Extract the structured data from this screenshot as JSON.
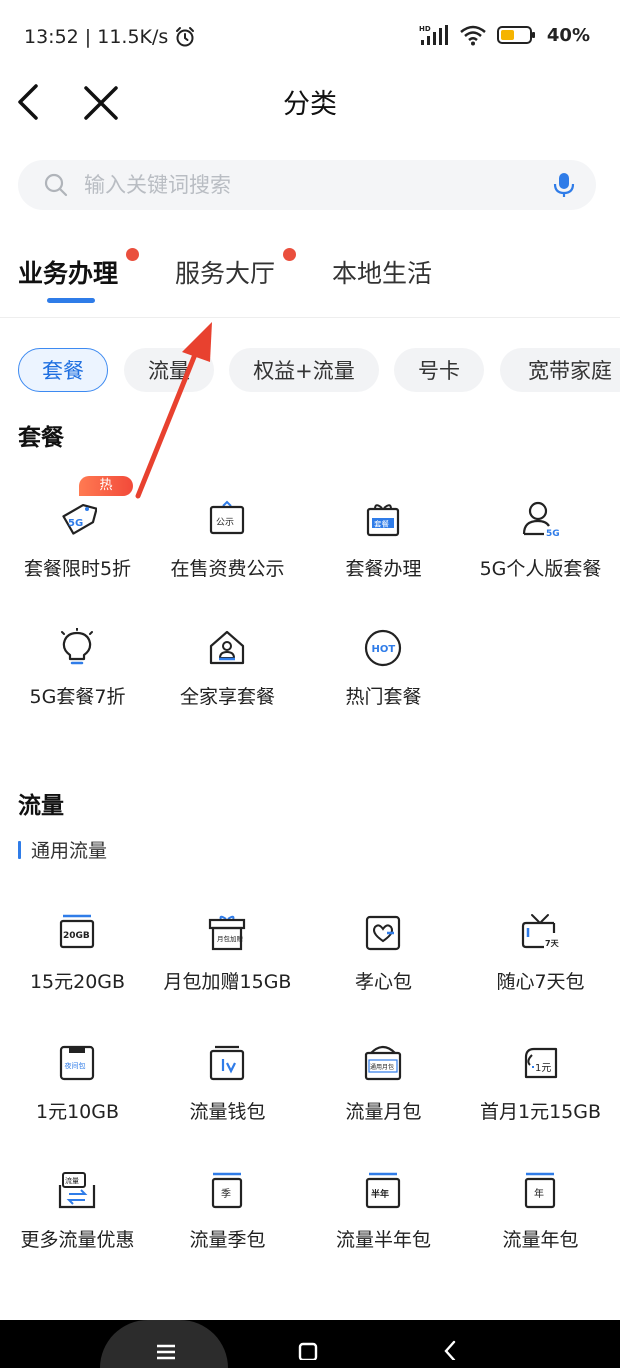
{
  "status_bar": {
    "time_speed": "13:52 | 11.5K/s",
    "hd": "HD",
    "battery": "40%"
  },
  "nav": {
    "title": "分类"
  },
  "search": {
    "placeholder": "输入关键词搜索"
  },
  "tabs": [
    {
      "label": "业务办理",
      "active": true,
      "dot": true
    },
    {
      "label": "服务大厅",
      "active": false,
      "dot": true
    },
    {
      "label": "本地生活",
      "active": false,
      "dot": false
    }
  ],
  "chips": [
    {
      "label": "套餐",
      "active": true
    },
    {
      "label": "流量",
      "active": false
    },
    {
      "label": "权益+流量",
      "active": false
    },
    {
      "label": "号卡",
      "active": false
    },
    {
      "label": "宽带家庭",
      "active": false
    }
  ],
  "section_plan": {
    "title": "套餐",
    "hot_badge": "热",
    "items": [
      {
        "label": "套餐限时5折",
        "icon": "5g-tag-icon",
        "icon_text": "5G"
      },
      {
        "label": "在售资费公示",
        "icon": "notice-board-icon",
        "icon_text": "公示"
      },
      {
        "label": "套餐办理",
        "icon": "gift-box-icon",
        "icon_text": "套餐"
      },
      {
        "label": "5G个人版套餐",
        "icon": "user-5g-icon",
        "icon_text": "5G"
      },
      {
        "label": "5G套餐7折",
        "icon": "lightbulb-icon",
        "icon_text": ""
      },
      {
        "label": "全家享套餐",
        "icon": "family-house-icon",
        "icon_text": ""
      },
      {
        "label": "热门套餐",
        "icon": "hot-circle-icon",
        "icon_text": "HOT"
      }
    ]
  },
  "section_data": {
    "title": "流量",
    "subtitle": "通用流量",
    "items": [
      {
        "label": "15元20GB",
        "icon": "data-card-icon",
        "icon_text": "20GB"
      },
      {
        "label": "月包加赠15GB",
        "icon": "gift-package-icon",
        "icon_text": "月包加赠"
      },
      {
        "label": "孝心包",
        "icon": "heart-card-icon",
        "icon_text": ""
      },
      {
        "label": "随心7天包",
        "icon": "tv-7day-icon",
        "icon_text": "7天"
      },
      {
        "label": "1元10GB",
        "icon": "night-pack-icon",
        "icon_text": "夜间包"
      },
      {
        "label": "流量钱包",
        "icon": "wallet-icon",
        "icon_text": ""
      },
      {
        "label": "流量月包",
        "icon": "monthly-pack-icon",
        "icon_text": "通用月包"
      },
      {
        "label": "首月1元15GB",
        "icon": "coupon-1yuan-icon",
        "icon_text": "1元"
      },
      {
        "label": "更多流量优惠",
        "icon": "data-exchange-icon",
        "icon_text": "流量"
      },
      {
        "label": "流量季包",
        "icon": "quarter-pack-icon",
        "icon_text": "季"
      },
      {
        "label": "流量半年包",
        "icon": "half-year-pack-icon",
        "icon_text": "半年"
      },
      {
        "label": "流量年包",
        "icon": "year-pack-icon",
        "icon_text": "年"
      }
    ]
  },
  "colors": {
    "accent": "#2f7ce8",
    "dot": "#ea4f3d",
    "arrow": "#e8412f",
    "badge": "#f24a3a"
  }
}
